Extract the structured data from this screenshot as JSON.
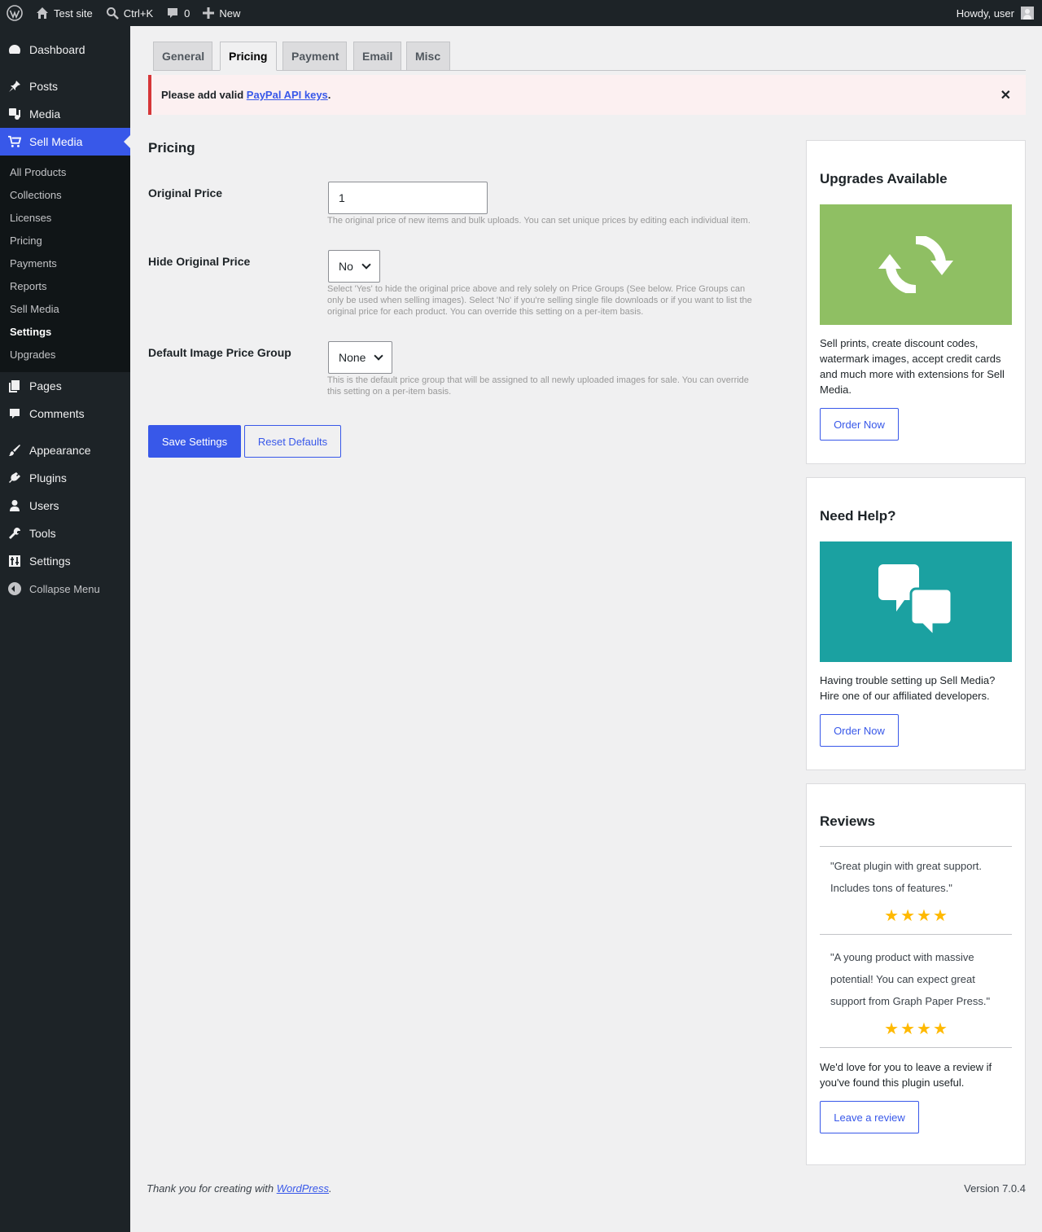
{
  "adminbar": {
    "site_name": "Test site",
    "search_shortcut": "Ctrl+K",
    "comments_count": "0",
    "new_label": "New",
    "greeting": "Howdy, user"
  },
  "sidebar": {
    "items": [
      {
        "label": "Dashboard",
        "icon": "dashboard-icon"
      },
      {
        "label": "Posts",
        "icon": "pin-icon"
      },
      {
        "label": "Media",
        "icon": "media-icon"
      },
      {
        "label": "Sell Media",
        "icon": "cart-icon"
      }
    ],
    "submenu": [
      "All Products",
      "Collections",
      "Licenses",
      "Pricing",
      "Payments",
      "Reports",
      "Sell Media",
      "Settings",
      "Upgrades"
    ],
    "items2": [
      {
        "label": "Pages",
        "icon": "pages-icon"
      },
      {
        "label": "Comments",
        "icon": "comment-icon"
      },
      {
        "label": "Appearance",
        "icon": "brush-icon"
      },
      {
        "label": "Plugins",
        "icon": "plug-icon"
      },
      {
        "label": "Users",
        "icon": "user-icon"
      },
      {
        "label": "Tools",
        "icon": "wrench-icon"
      },
      {
        "label": "Settings",
        "icon": "settings-icon"
      }
    ],
    "collapse": "Collapse Menu"
  },
  "tabs": [
    "General",
    "Pricing",
    "Payment",
    "Email",
    "Misc"
  ],
  "notice": {
    "prefix": "Please add valid ",
    "link": "PayPal API keys",
    "suffix": ".",
    "dismiss": "✕"
  },
  "form": {
    "title": "Pricing",
    "original_price": {
      "label": "Original Price",
      "value": "1",
      "description": "The original price of new items and bulk uploads. You can set unique prices by editing each individual item."
    },
    "hide_original_price": {
      "label": "Hide Original Price",
      "value": "No",
      "description": "Select 'Yes' to hide the original price above and rely solely on Price Groups (See below. Price Groups can only be used when selling images). Select 'No' if you're selling single file downloads or if you want to list the original price for each product. You can override this setting on a per-item basis."
    },
    "default_price_group": {
      "label": "Default Image Price Group",
      "value": "None",
      "description": "This is the default price group that will be assigned to all newly uploaded images for sale. You can override this setting on a per-item basis."
    },
    "save_label": "Save Settings",
    "reset_label": "Reset Defaults"
  },
  "upgrades_box": {
    "title": "Upgrades Available",
    "text": "Sell prints, create discount codes, watermark images, accept credit cards and much more with extensions for Sell Media.",
    "button": "Order Now",
    "banner_color": "#8fbf63"
  },
  "help_box": {
    "title": "Need Help?",
    "text": "Having trouble setting up Sell Media? Hire one of our affiliated developers.",
    "button": "Order Now",
    "banner_color": "#1ba1a1"
  },
  "reviews_box": {
    "title": "Reviews",
    "reviews": [
      {
        "quote": "\"Great plugin with great support. Includes tons of features.\"",
        "stars": 4
      },
      {
        "quote": "\"A young product with massive potential! You can expect great support from Graph Paper Press.\"",
        "stars": 4
      }
    ],
    "text": "We'd love for you to leave a review if you've found this plugin useful.",
    "button": "Leave a review"
  },
  "footer": {
    "thanks_prefix": "Thank you for creating with ",
    "thanks_link": "WordPress",
    "thanks_suffix": ".",
    "version": "Version 7.0.4"
  },
  "colors": {
    "accent": "#3858e9",
    "admin_bg": "#1d2327",
    "error": "#d63638"
  }
}
